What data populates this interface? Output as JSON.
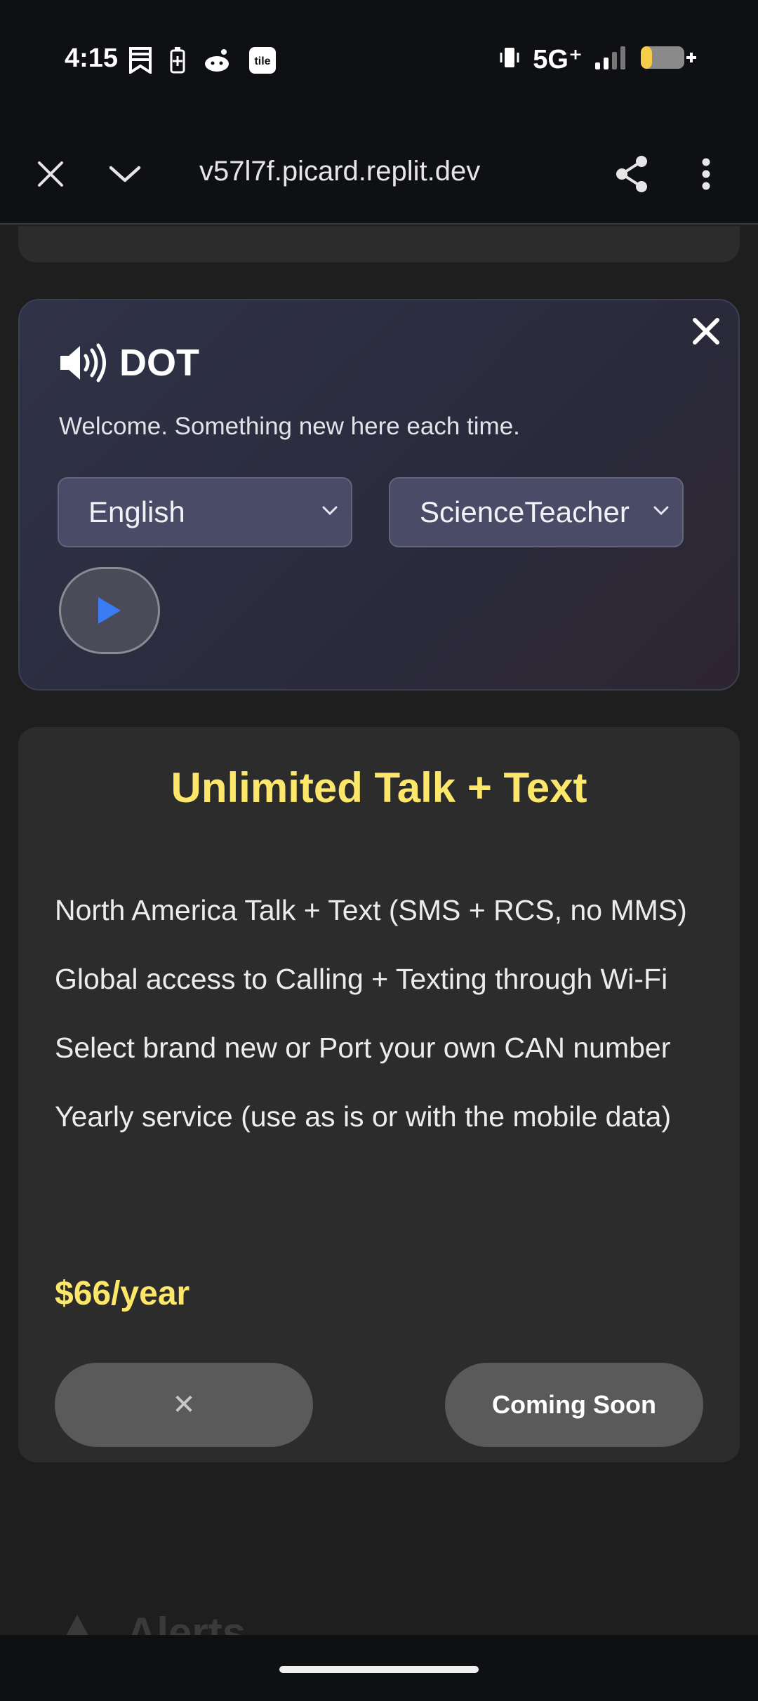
{
  "status_bar": {
    "time": "4:15",
    "network": "5G⁺",
    "left_icons": [
      "bookmark-icon",
      "battery-saver-icon",
      "reddit-icon",
      "tile-app-icon"
    ],
    "tile_label": "tile",
    "right_icons": [
      "vibrate-icon",
      "signal-icon",
      "battery-icon"
    ]
  },
  "browser": {
    "url": "v57l7f.picard.replit.dev",
    "icons": [
      "close-icon",
      "chevron-down-icon",
      "share-icon",
      "more-vert-icon"
    ]
  },
  "dot_panel": {
    "title": "DOT",
    "welcome": "Welcome. Something new here each time.",
    "language_select": "English",
    "voice_select": "ScienceTeacher",
    "icons": [
      "speaker-icon",
      "close-icon",
      "play-icon"
    ]
  },
  "plan": {
    "title": "Unlimited Talk + Text",
    "features": [
      "North America Talk + Text (SMS + RCS, no MMS)",
      "Global access to Calling + Texting through Wi-Fi",
      "Select brand new or Port your own CAN number",
      "Yearly service (use as is or with the mobile data)"
    ],
    "price": "$66/year",
    "left_button": "✕",
    "right_button": "Coming Soon"
  },
  "peek_section": {
    "label": "Alerts",
    "icon": "warning-icon"
  },
  "colors": {
    "accent_yellow": "#fde76b",
    "play_blue": "#3b7cf5",
    "card_bg": "#2c2c2c",
    "page_bg": "#1e1e1e"
  }
}
